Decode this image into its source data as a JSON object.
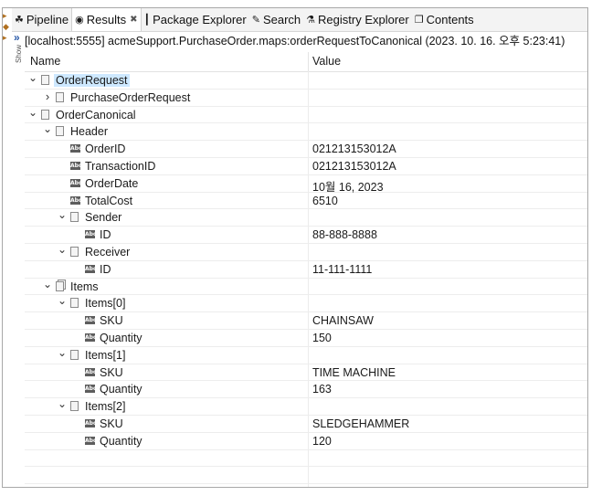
{
  "tabs": [
    {
      "id": "pipeline",
      "label": "Pipeline",
      "icon": "pipeline-icon",
      "glyph": "☘"
    },
    {
      "id": "results",
      "label": "Results",
      "icon": "results-icon",
      "glyph": "◉",
      "active": true
    },
    {
      "id": "package-explorer",
      "label": "Package Explorer",
      "icon": "package-explorer-icon",
      "glyph": "┃"
    },
    {
      "id": "search",
      "label": "Search",
      "icon": "search-icon",
      "glyph": "✎"
    },
    {
      "id": "registry-explorer",
      "label": "Registry Explorer",
      "icon": "registry-explorer-icon",
      "glyph": "⚗"
    },
    {
      "id": "contents",
      "label": "Contents",
      "icon": "contents-icon",
      "glyph": "❐"
    }
  ],
  "side": {
    "show_label": "Show",
    "expand_glyph": "»"
  },
  "path": "[localhost:5555] acmeSupport.PurchaseOrder.maps:orderRequestToCanonical (2023. 10. 16. 오후 5:23:41)",
  "columns": {
    "name": "Name",
    "value": "Value"
  },
  "rows": [
    {
      "depth": 0,
      "label": "OrderRequest",
      "value": "",
      "type": "doc",
      "toggle": "expanded",
      "selected": true
    },
    {
      "depth": 1,
      "label": "PurchaseOrderRequest",
      "value": "",
      "type": "doc",
      "toggle": "collapsed"
    },
    {
      "depth": 0,
      "label": "OrderCanonical",
      "value": "",
      "type": "doc",
      "toggle": "expanded"
    },
    {
      "depth": 1,
      "label": "Header",
      "value": "",
      "type": "doc",
      "toggle": "expanded"
    },
    {
      "depth": 2,
      "label": "OrderID",
      "value": "021213153012A",
      "type": "string"
    },
    {
      "depth": 2,
      "label": "TransactionID",
      "value": "021213153012A",
      "type": "string"
    },
    {
      "depth": 2,
      "label": "OrderDate",
      "value": "10월 16, 2023",
      "type": "string"
    },
    {
      "depth": 2,
      "label": "TotalCost",
      "value": "6510",
      "type": "string"
    },
    {
      "depth": 2,
      "label": "Sender",
      "value": "",
      "type": "doc",
      "toggle": "expanded"
    },
    {
      "depth": 3,
      "label": "ID",
      "value": "88-888-8888",
      "type": "string"
    },
    {
      "depth": 2,
      "label": "Receiver",
      "value": "",
      "type": "doc",
      "toggle": "expanded"
    },
    {
      "depth": 3,
      "label": "ID",
      "value": "11-111-1111",
      "type": "string"
    },
    {
      "depth": 1,
      "label": "Items",
      "value": "",
      "type": "doclist",
      "toggle": "expanded"
    },
    {
      "depth": 2,
      "label": "Items[0]",
      "value": "",
      "type": "doc",
      "toggle": "expanded"
    },
    {
      "depth": 3,
      "label": "SKU",
      "value": "CHAINSAW",
      "type": "string"
    },
    {
      "depth": 3,
      "label": "Quantity",
      "value": "150",
      "type": "string"
    },
    {
      "depth": 2,
      "label": "Items[1]",
      "value": "",
      "type": "doc",
      "toggle": "expanded"
    },
    {
      "depth": 3,
      "label": "SKU",
      "value": "TIME MACHINE",
      "type": "string"
    },
    {
      "depth": 3,
      "label": "Quantity",
      "value": "163",
      "type": "string"
    },
    {
      "depth": 2,
      "label": "Items[2]",
      "value": "",
      "type": "doc",
      "toggle": "expanded"
    },
    {
      "depth": 3,
      "label": "SKU",
      "value": "SLEDGEHAMMER",
      "type": "string"
    },
    {
      "depth": 3,
      "label": "Quantity",
      "value": "120",
      "type": "string"
    },
    {
      "depth": 0,
      "label": "",
      "value": "",
      "type": "empty"
    },
    {
      "depth": 0,
      "label": "",
      "value": "",
      "type": "empty"
    }
  ],
  "colors": {
    "selection": "#cde8ff",
    "tab_bar": "#f3f3f3",
    "string_icon": "#5d5d5d"
  }
}
